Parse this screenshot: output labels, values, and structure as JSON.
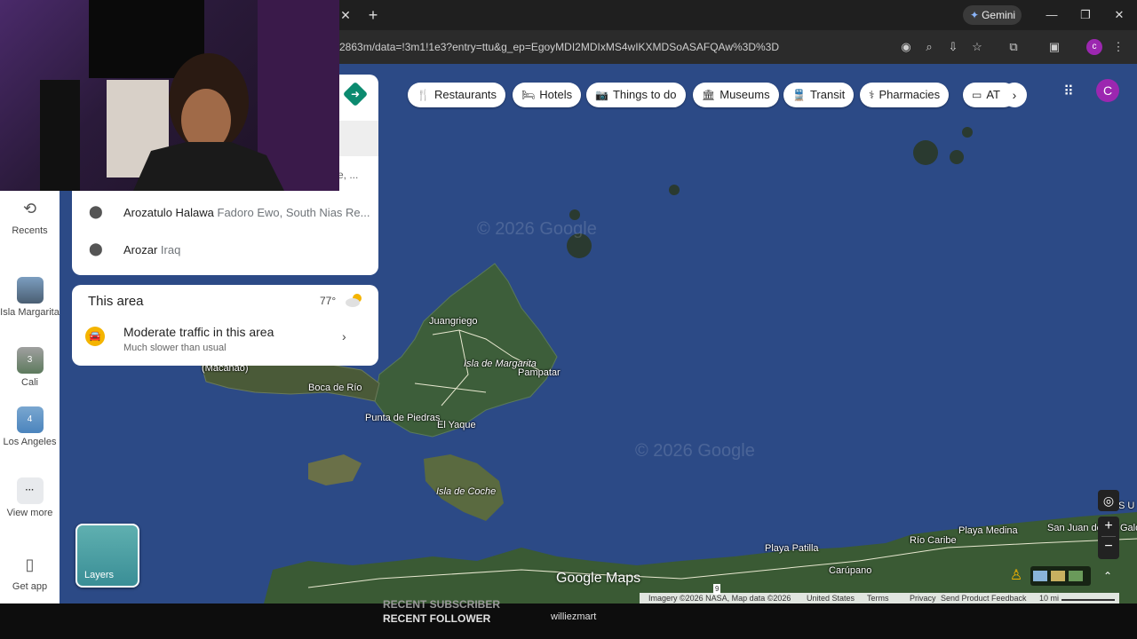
{
  "browser": {
    "url": "2863m/data=!3m1!1e3?entry=ttu&g_ep=EgoyMDI2MDIxMS4wIKXMDSoASAFQAw%3D%3D",
    "gemini_label": "Gemini",
    "profile_letter": "c"
  },
  "rail": {
    "items": [
      {
        "label": "Recents"
      },
      {
        "label": "Isla Margarita"
      },
      {
        "label": "Cali",
        "badge": "3"
      },
      {
        "label": "Los Angeles",
        "badge": "4"
      },
      {
        "label": "View more"
      },
      {
        "label": "Get app"
      }
    ]
  },
  "search": {
    "truncated_text": "e, ...",
    "results": [
      {
        "name": "Arozatulo Halawa",
        "detail": "Fadoro Ewo, South Nias Re..."
      },
      {
        "name": "Arozar",
        "detail": "Iraq"
      }
    ]
  },
  "area_card": {
    "title": "This area",
    "temperature": "77°",
    "traffic_title": "Moderate traffic in this area",
    "traffic_subtitle": "Much slower than usual"
  },
  "categories": [
    "Restaurants",
    "Hotels",
    "Things to do",
    "Museums",
    "Transit",
    "Pharmacies",
    "AT"
  ],
  "account_letter": "C",
  "map": {
    "labels": {
      "juangriego": "Juangriego",
      "isla_margarita": "Isla de Margarita",
      "pampatar": "Pampatar",
      "macanao": "(Macanao)",
      "boca_de_rio": "Boca de Río",
      "punta_de_piedras": "Punta de Piedras",
      "el_yaque": "El Yaque",
      "isla_de_coche": "Isla de Coche",
      "playa_patilla": "Playa Patilla",
      "rio_caribe": "Río Caribe",
      "playa_medina": "Playa Medina",
      "carupano": "Carúpano",
      "san_juan": "San Juan de las Galdonas",
      "edge_label": "S U",
      "road_number": "9"
    },
    "watermark": "© 2026 Google",
    "logo": "Google Maps",
    "layers_label": "Layers",
    "footer": {
      "imagery": "Imagery ©2026 NASA, Map data ©2026",
      "country": "United States",
      "terms": "Terms",
      "privacy": "Privacy",
      "feedback": "Send Product Feedback",
      "scale": "10 mi"
    }
  },
  "stream": {
    "subscriber": "RECENT SUBSCRIBER",
    "follower": "RECENT FOLLOWER",
    "follower_name": "williezmart"
  },
  "colors": {
    "ocean": "#2c4a86",
    "land": "#3a5a3a",
    "accent_green": "#0b8a6f",
    "account": "#9c27b0"
  }
}
